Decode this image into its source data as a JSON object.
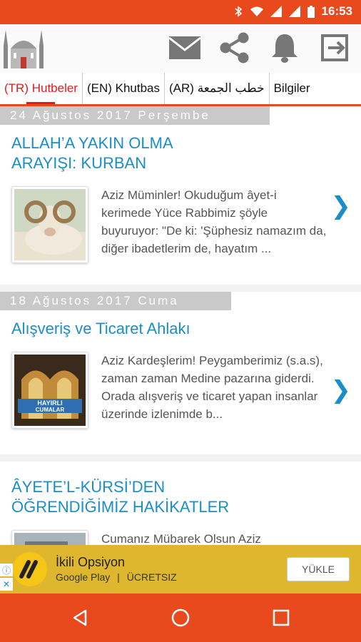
{
  "statusbar": {
    "time": "16:53"
  },
  "tabs": [
    {
      "label": "(TR) Hutbeler"
    },
    {
      "label": "(EN) Khutbas"
    },
    {
      "label": "(AR) خطب الجمعة"
    },
    {
      "label": "Bilgiler"
    }
  ],
  "articles": [
    {
      "date": "24 Ağustos 2017 Perşembe",
      "title": "ALLAH’A YAKIN OLMA ARAYIŞI: KURBAN",
      "excerpt": "Aziz Müminler! Okuduğum âyet-i kerimede Yüce Rabbimiz şöyle buyuruyor: \"De ki: 'Şüphesiz namazım da, diğer ibadetlerim de, hayatım ..."
    },
    {
      "date": "18 Ağustos 2017 Cuma",
      "title": "Alışveriş ve Ticaret Ahlakı",
      "excerpt": "Aziz Kardeşlerim! Peygamberimiz (s.a.s), zaman zaman Medine pazarına giderdi. Orada alışveriş ve ticaret yapan insanlar üzerinde izlenimde b...",
      "thumb_text_1": "HAYIRLI",
      "thumb_text_2": "CUMALAR"
    },
    {
      "title": "ÂYETE’L-KÜRSİ’DEN ÖĞRENDİĞİMİZ HAKİKATLER",
      "excerpt": "Cumanız Mübarek Olsun Aziz"
    }
  ],
  "ad": {
    "title": "İkili Opsiyon",
    "store": "Google Play",
    "separator": "|",
    "price": "ÜCRETSIZ",
    "button": "YÜKLE"
  },
  "colors": {
    "primary": "#e8491d",
    "link": "#1a8ec8",
    "active_tab": "#e01b1b",
    "ad_bg": "#dfb72e"
  }
}
